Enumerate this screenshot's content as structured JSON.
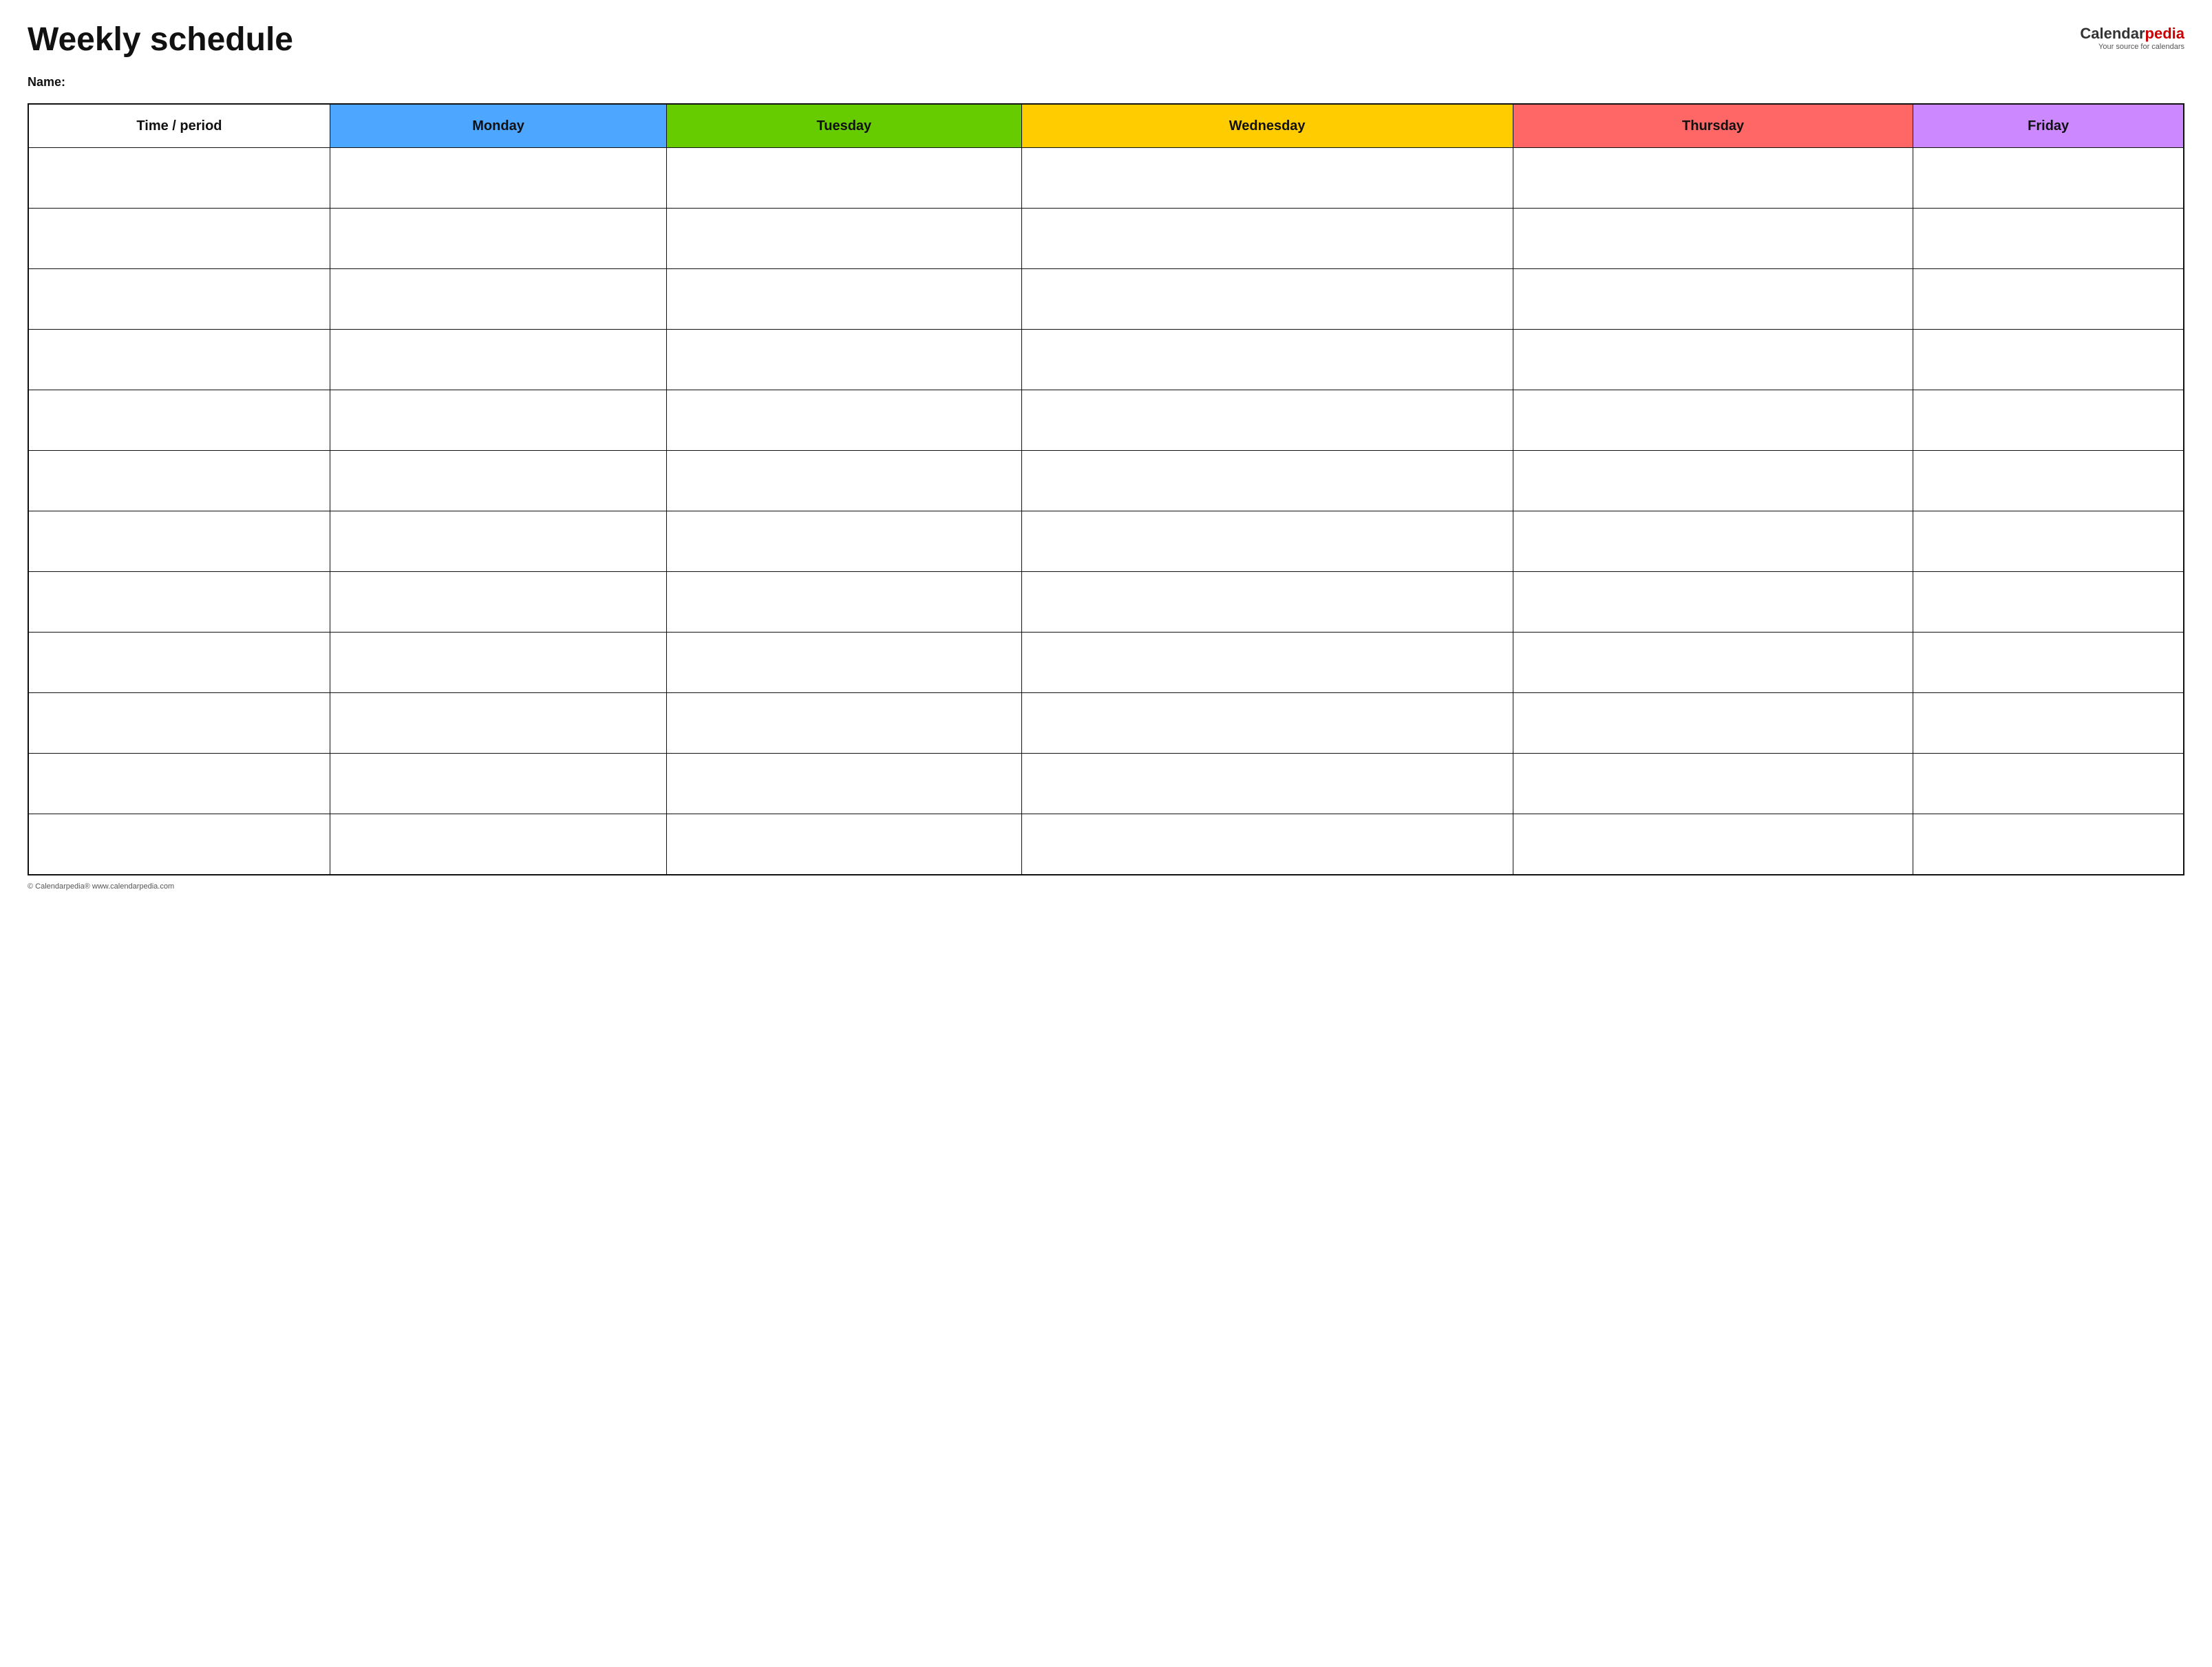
{
  "header": {
    "title": "Weekly schedule",
    "logo_calendar": "Calendar",
    "logo_pedia": "pedia",
    "logo_tagline": "Your source for calendars"
  },
  "name_label": "Name:",
  "columns": [
    {
      "key": "time",
      "label": "Time / period",
      "color": "#ffffff"
    },
    {
      "key": "monday",
      "label": "Monday",
      "color": "#4da6ff"
    },
    {
      "key": "tuesday",
      "label": "Tuesday",
      "color": "#66cc00"
    },
    {
      "key": "wednesday",
      "label": "Wednesday",
      "color": "#ffcc00"
    },
    {
      "key": "thursday",
      "label": "Thursday",
      "color": "#ff6666"
    },
    {
      "key": "friday",
      "label": "Friday",
      "color": "#cc88ff"
    }
  ],
  "rows": 12,
  "footer": "© Calendarpedia®  www.calendarpedia.com"
}
